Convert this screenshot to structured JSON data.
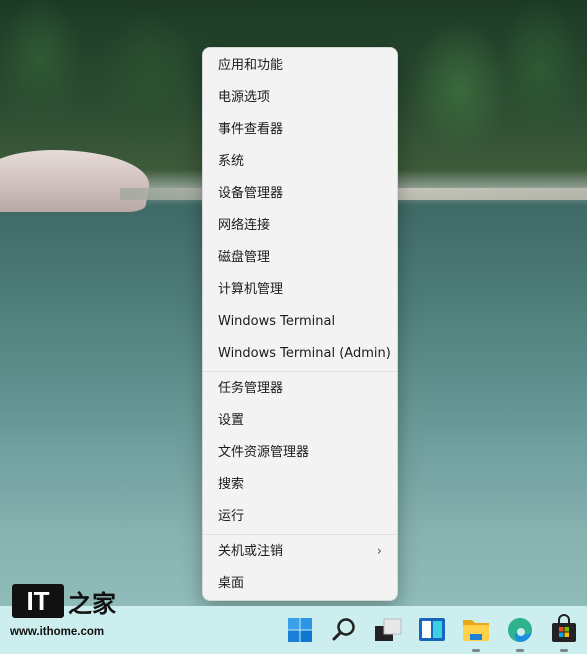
{
  "menu": {
    "items": [
      {
        "label": "应用和功能"
      },
      {
        "label": "电源选项"
      },
      {
        "label": "事件查看器"
      },
      {
        "label": "系统"
      },
      {
        "label": "设备管理器"
      },
      {
        "label": "网络连接"
      },
      {
        "label": "磁盘管理"
      },
      {
        "label": "计算机管理"
      },
      {
        "label": "Windows Terminal"
      },
      {
        "label": "Windows Terminal (Admin)"
      },
      {
        "label": "任务管理器"
      },
      {
        "label": "设置"
      },
      {
        "label": "文件资源管理器"
      },
      {
        "label": "搜索"
      },
      {
        "label": "运行"
      },
      {
        "label": "关机或注销"
      },
      {
        "label": "桌面"
      }
    ],
    "chevron": "›"
  },
  "watermark": {
    "logo": "IT之家",
    "url": "www.ithome.com"
  },
  "taskbar": {
    "icons": [
      "windows-start-icon",
      "search-icon",
      "task-view-icon",
      "widgets-icon",
      "file-explorer-icon",
      "edge-icon",
      "store-icon"
    ]
  },
  "colors": {
    "taskbar": "#cdeeee",
    "menu": "#f3f3f3",
    "accent": "#0078d4"
  }
}
